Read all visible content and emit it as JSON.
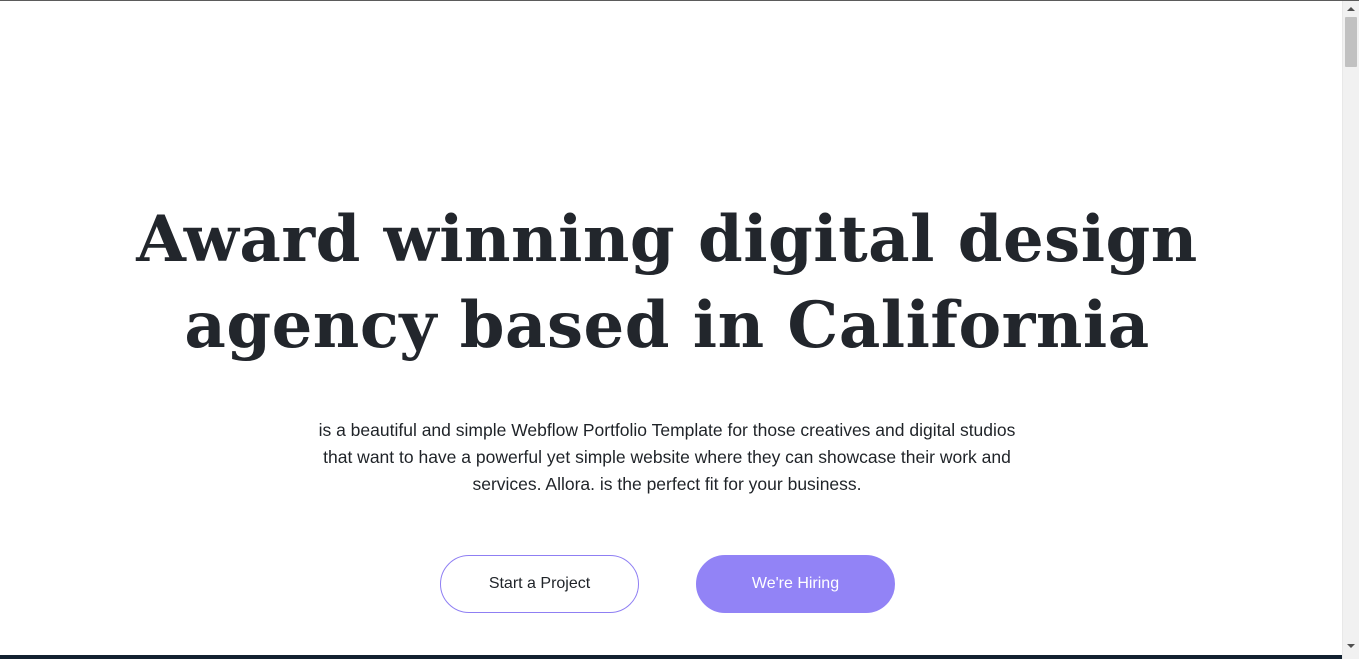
{
  "hero": {
    "title_line1": "Award winning digital design",
    "title_line2": "agency based in California",
    "description_line1": "is a beautiful and simple Webflow Portfolio Template for those creatives and digital studios",
    "description_line2": "that want to have a powerful yet simple website where they can showcase their work and",
    "description_line3": "services. Allora. is the perfect fit for your business."
  },
  "buttons": {
    "start_project": "Start a Project",
    "hiring": "We're Hiring"
  },
  "scrollbar": {
    "up_icon": "chevron-up-icon",
    "down_icon": "chevron-down-icon"
  },
  "colors": {
    "accent": "#9283f6",
    "text": "#22262c",
    "footer_dark": "#122130"
  }
}
